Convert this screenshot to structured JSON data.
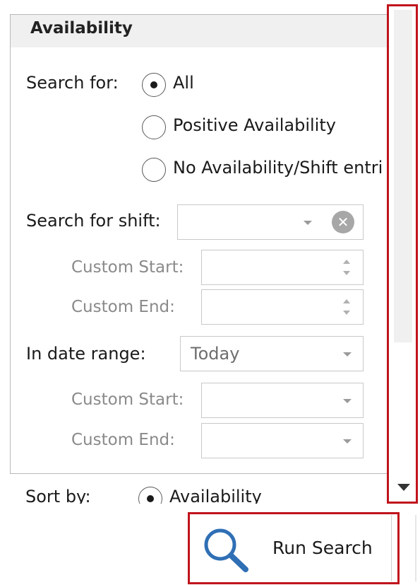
{
  "panel": {
    "title": "Availability",
    "search_for": {
      "label": "Search for:",
      "options": [
        {
          "label": "All",
          "checked": true
        },
        {
          "label": "Positive Availability",
          "checked": false
        },
        {
          "label": "No Availability/Shift entri",
          "checked": false
        }
      ]
    },
    "search_for_shift": {
      "label": "Search for shift:",
      "value": "",
      "clear_icon": "clear-circle-x-icon",
      "custom_start_label": "Custom Start:",
      "custom_start_value": "",
      "custom_end_label": "Custom End:",
      "custom_end_value": ""
    },
    "date_range": {
      "label": "In date range:",
      "value": "Today",
      "custom_start_label": "Custom Start:",
      "custom_start_value": "",
      "custom_end_label": "Custom End:",
      "custom_end_value": ""
    }
  },
  "sort": {
    "label": "Sort by:",
    "option": "Availability",
    "checked": true
  },
  "run_search": {
    "label": "Run Search",
    "icon": "search-icon"
  },
  "colors": {
    "highlight": "#c0141c",
    "search_icon": "#2f6fb5"
  }
}
